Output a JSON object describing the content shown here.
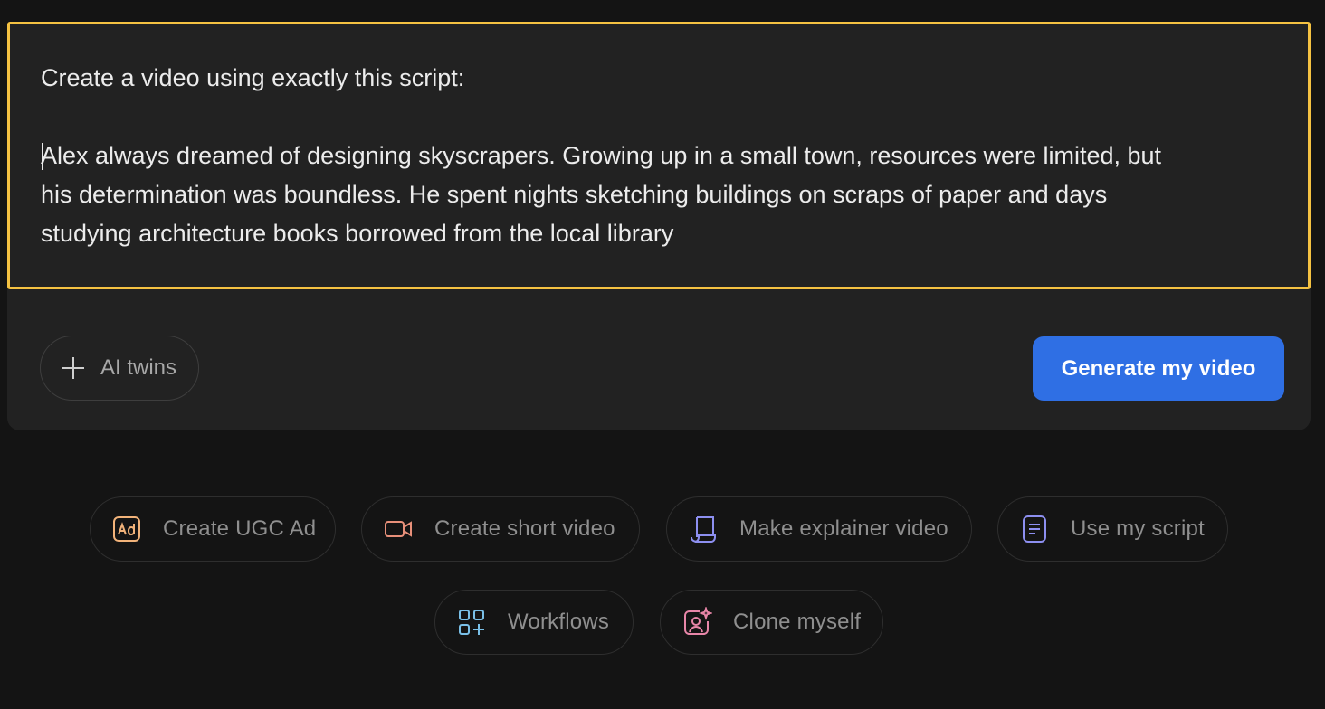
{
  "editor": {
    "lines": [
      "Create a video using exactly this script:",
      "Alex always dreamed of designing skyscrapers. Growing up in a small town, resources were limited, but",
      "his determination was boundless. He spent nights sketching buildings on scraps of paper and days",
      "studying architecture books borrowed from the local library"
    ],
    "highlight_color": "#f5c242"
  },
  "toolbar": {
    "twins_label": "AI twins",
    "generate_label": "Generate my video",
    "generate_color": "#2f6fe4"
  },
  "chips": [
    {
      "label": "Create UGC Ad",
      "icon": "ad-icon",
      "color": "#f2b37a"
    },
    {
      "label": "Create short video",
      "icon": "video-camera-icon",
      "color": "#e8907a"
    },
    {
      "label": "Make explainer video",
      "icon": "scroll-icon",
      "color": "#8d8ff0"
    },
    {
      "label": "Use my script",
      "icon": "document-icon",
      "color": "#8d8ff0"
    },
    {
      "label": "Workflows",
      "icon": "grid-plus-icon",
      "color": "#7ac0e8"
    },
    {
      "label": "Clone myself",
      "icon": "sparkle-portrait-icon",
      "color": "#e886a8"
    }
  ]
}
